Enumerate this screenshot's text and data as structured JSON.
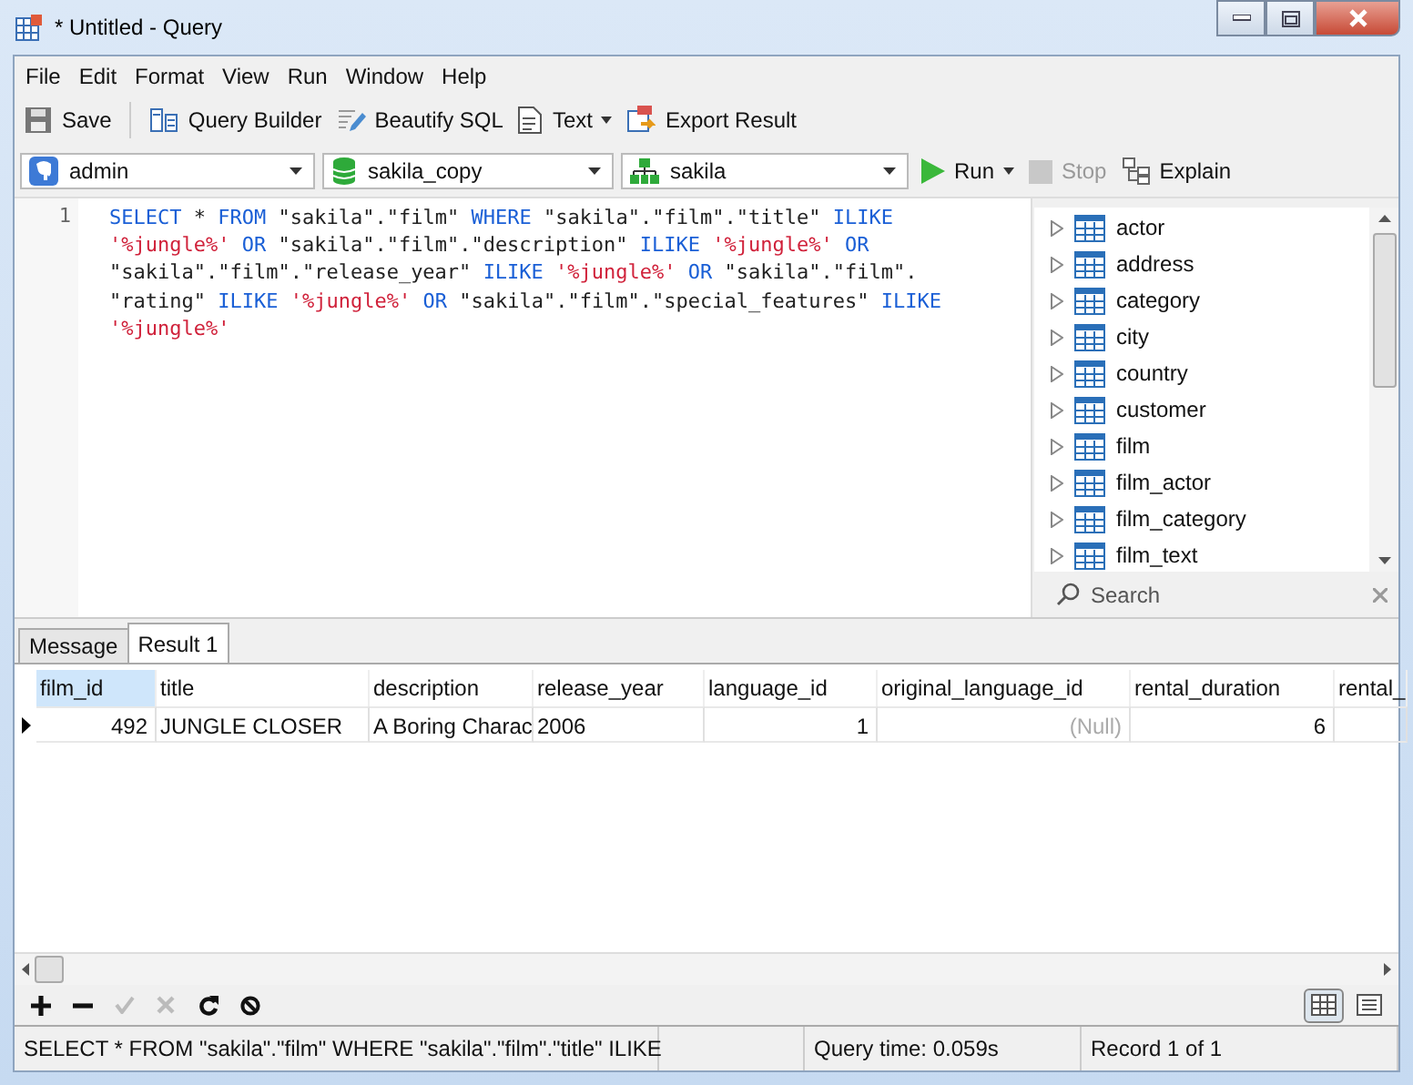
{
  "window": {
    "title": "* Untitled - Query"
  },
  "menu": [
    "File",
    "Edit",
    "Format",
    "View",
    "Run",
    "Window",
    "Help"
  ],
  "toolbar": [
    {
      "label": "Save"
    },
    {
      "label": "Query Builder"
    },
    {
      "label": "Beautify SQL"
    },
    {
      "label": "Text"
    },
    {
      "label": "Export Result"
    }
  ],
  "selectors": [
    {
      "value": "admin"
    },
    {
      "value": "sakila_copy"
    },
    {
      "value": "sakila"
    }
  ],
  "run": {
    "label": "Run",
    "disabled": false
  },
  "stop": {
    "label": "Stop",
    "disabled": true
  },
  "explain": {
    "label": "Explain"
  },
  "editor": {
    "line_numbers": [
      "1"
    ],
    "lines": [
      [
        {
          "kind": "kw",
          "text": "SELECT"
        },
        {
          "kind": "plain",
          "text": " * "
        },
        {
          "kind": "kw",
          "text": "FROM"
        },
        {
          "kind": "plain",
          "text": " \"sakila\".\"film\" "
        },
        {
          "kind": "kw",
          "text": "WHERE"
        },
        {
          "kind": "plain",
          "text": " \"sakila\".\"film\".\"title\" "
        },
        {
          "kind": "kw",
          "text": "ILIKE"
        }
      ],
      [
        {
          "kind": "str",
          "text": "'%jungle%'"
        },
        {
          "kind": "kw",
          "text": " OR"
        },
        {
          "kind": "plain",
          "text": " \"sakila\".\"film\".\"description\" "
        },
        {
          "kind": "kw",
          "text": "ILIKE"
        },
        {
          "kind": "str",
          "text": " '%jungle%'"
        },
        {
          "kind": "kw",
          "text": " OR"
        }
      ],
      [
        {
          "kind": "plain",
          "text": "\"sakila\".\"film\".\"release_year\" "
        },
        {
          "kind": "kw",
          "text": "ILIKE"
        },
        {
          "kind": "str",
          "text": " '%jungle%'"
        },
        {
          "kind": "kw",
          "text": " OR"
        },
        {
          "kind": "plain",
          "text": " \"sakila\".\"film\"."
        }
      ],
      [
        {
          "kind": "plain",
          "text": "\"rating\" "
        },
        {
          "kind": "kw",
          "text": "ILIKE"
        },
        {
          "kind": "str",
          "text": " '%jungle%'"
        },
        {
          "kind": "kw",
          "text": " OR"
        },
        {
          "kind": "plain",
          "text": " \"sakila\".\"film\".\"special_features\" "
        },
        {
          "kind": "kw",
          "text": "ILIKE"
        }
      ],
      [
        {
          "kind": "str",
          "text": "'%jungle%'"
        }
      ]
    ]
  },
  "objects": {
    "items": [
      {
        "name": "actor",
        "expanded": false
      },
      {
        "name": "address",
        "expanded": false
      },
      {
        "name": "category",
        "expanded": false
      },
      {
        "name": "city",
        "expanded": false
      },
      {
        "name": "country",
        "expanded": false
      },
      {
        "name": "customer",
        "expanded": false
      },
      {
        "name": "film",
        "expanded": false
      },
      {
        "name": "film_actor",
        "expanded": false
      },
      {
        "name": "film_category",
        "expanded": false
      },
      {
        "name": "film_text",
        "expanded": false
      }
    ],
    "search": {
      "placeholder": "Search"
    }
  },
  "tabs": [
    {
      "label": "Message",
      "selected": false
    },
    {
      "label": "Result 1",
      "selected": true
    }
  ],
  "table": {
    "columns": [
      {
        "label": "film_id",
        "selected": true
      },
      {
        "label": "title",
        "selected": false
      },
      {
        "label": "description",
        "selected": false
      },
      {
        "label": "release_year",
        "selected": false
      },
      {
        "label": "language_id",
        "selected": false
      },
      {
        "label": "original_language_id",
        "selected": false
      },
      {
        "label": "rental_duration",
        "selected": false
      },
      {
        "label": "rental_",
        "selected": false
      }
    ],
    "rows": [
      [
        {
          "kind": "num",
          "text": "492"
        },
        {
          "kind": "text",
          "text": "JUNGLE CLOSER"
        },
        {
          "kind": "text",
          "text": "A Boring Charac"
        },
        {
          "kind": "text",
          "text": "2006"
        },
        {
          "kind": "num",
          "text": "1"
        },
        {
          "kind": "null",
          "text": "(Null)"
        },
        {
          "kind": "num",
          "text": "6"
        },
        {
          "kind": "text",
          "text": ""
        }
      ]
    ]
  },
  "grid_actions": [
    {
      "kind": "add",
      "disabled": false
    },
    {
      "kind": "remove",
      "disabled": false
    },
    {
      "kind": "apply",
      "disabled": true
    },
    {
      "kind": "discard",
      "disabled": true
    },
    {
      "kind": "refresh",
      "disabled": false
    },
    {
      "kind": "stop",
      "disabled": false
    }
  ],
  "views": [
    {
      "kind": "grid",
      "selected": true
    },
    {
      "kind": "form",
      "selected": false
    }
  ],
  "status_bar": {
    "sql": "SELECT * FROM \"sakila\".\"film\" WHERE \"sakila\".\"film\".\"title\" ILIKE",
    "query_time": "Query time: 0.059s",
    "record": "Record 1 of 1"
  }
}
